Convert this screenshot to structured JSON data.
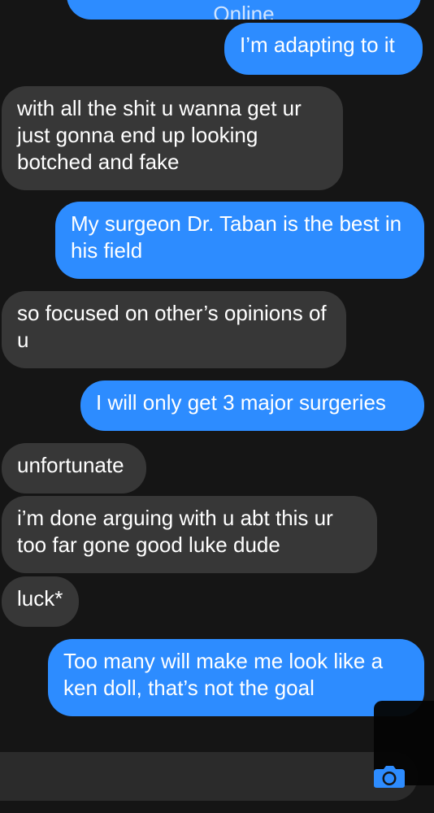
{
  "thread": {
    "top_fragment": "Online",
    "messages": [
      {
        "side": "sent",
        "text": "I’m adapting to it"
      },
      {
        "side": "received",
        "text": "with all the shit u wanna get ur just gonna end up looking botched and fake"
      },
      {
        "side": "sent",
        "text": "My surgeon Dr. Taban is the best in his field"
      },
      {
        "side": "received",
        "text": "so focused on other’s opinions of u"
      },
      {
        "side": "sent",
        "text": "I will only get 3 major surgeries"
      },
      {
        "side": "received",
        "text": "unfortunate"
      },
      {
        "side": "received",
        "text": "i’m done arguing with u abt this ur too far gone good luke dude"
      },
      {
        "side": "received",
        "text": "luck*"
      },
      {
        "side": "sent",
        "text": "Too many will make me look like a ken doll, that’s not the goal"
      }
    ]
  },
  "composer": {
    "camera_icon": "camera-icon"
  },
  "colors": {
    "background": "#151515",
    "sent_bubble": "#2d8cff",
    "received_bubble": "#373737",
    "composer": "#2b2b2b"
  }
}
